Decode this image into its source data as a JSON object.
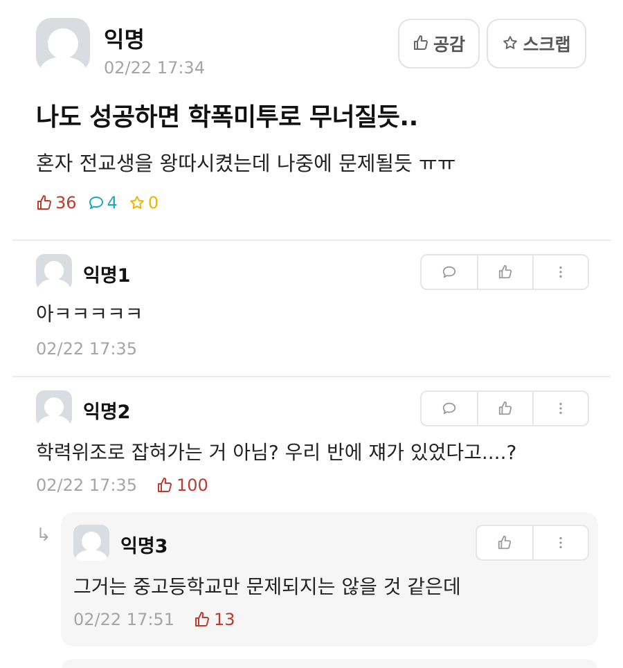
{
  "post": {
    "author": "익명",
    "time": "02/22 17:34",
    "like_button_label": "공감",
    "scrap_button_label": "스크랩",
    "title": "나도 성공하면 학폭미투로 무너질듯..",
    "body": "혼자 전교생을 왕따시켰는데 나중에 문제될듯 ㅠㅠ",
    "stats": {
      "likes": "36",
      "comments": "4",
      "scraps": "0"
    }
  },
  "comments": [
    {
      "author": "익명1",
      "text": "아ㅋㅋㅋㅋㅋ",
      "time": "02/22 17:35",
      "likes": ""
    },
    {
      "author": "익명2",
      "text": "학력위조로 잡혀가는 거 아님? 우리 반에 쟤가 있었다고....?",
      "time": "02/22 17:35",
      "likes": "100"
    }
  ],
  "reply": {
    "arrow": "↳",
    "author": "익명3",
    "text": "그거는 중고등학교만 문제되지는 않을 것 같은데",
    "time": "02/22 17:51",
    "likes": "13"
  },
  "colors": {
    "like": "#c0392b",
    "comment": "#1fa6bf",
    "scrap": "#f0b400",
    "muted": "#a5a5a5"
  },
  "icons": {
    "like": "thumbs-up-icon",
    "comment": "speech-bubble-icon",
    "scrap": "star-icon",
    "more": "vertical-dots-icon"
  }
}
